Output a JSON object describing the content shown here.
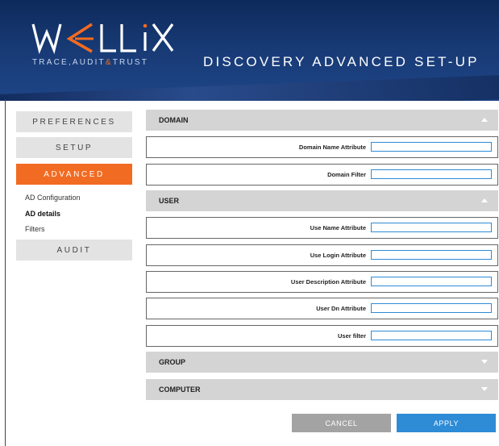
{
  "header": {
    "logo_text": "WALLIX",
    "tagline_part1": "TRACE,AUDIT",
    "tagline_amp": "&",
    "tagline_part2": "TRUST",
    "title": "DISCOVERY ADVANCED SET-UP"
  },
  "colors": {
    "header_bg": "#193c78",
    "accent_orange": "#f26b22",
    "apply_blue": "#2e8bd6",
    "cancel_gray": "#a3a3a3",
    "section_bar": "#d4d4d4"
  },
  "sidebar": {
    "preferences": "PREFERENCES",
    "setup": "SETUP",
    "advanced": "ADVANCED",
    "sub_items": [
      "AD Configuration",
      "AD details",
      "Filters"
    ],
    "audit": "AUDIT"
  },
  "sections": {
    "domain": {
      "title": "DOMAIN",
      "expanded": true,
      "fields": [
        {
          "label": "Domain Name Attribute",
          "value": ""
        },
        {
          "label": "Domain Filter",
          "value": ""
        }
      ]
    },
    "user": {
      "title": "USER",
      "expanded": true,
      "fields": [
        {
          "label": "Use Name Attribute",
          "value": ""
        },
        {
          "label": "Use Login Attribute",
          "value": ""
        },
        {
          "label": "User Description Attribute",
          "value": ""
        },
        {
          "label": "User Dn Attribute",
          "value": ""
        },
        {
          "label": "User filter",
          "value": ""
        }
      ]
    },
    "group": {
      "title": "GROUP",
      "expanded": false
    },
    "computer": {
      "title": "COMPUTER",
      "expanded": false
    }
  },
  "actions": {
    "cancel": "CANCEL",
    "apply": "APPLY"
  }
}
